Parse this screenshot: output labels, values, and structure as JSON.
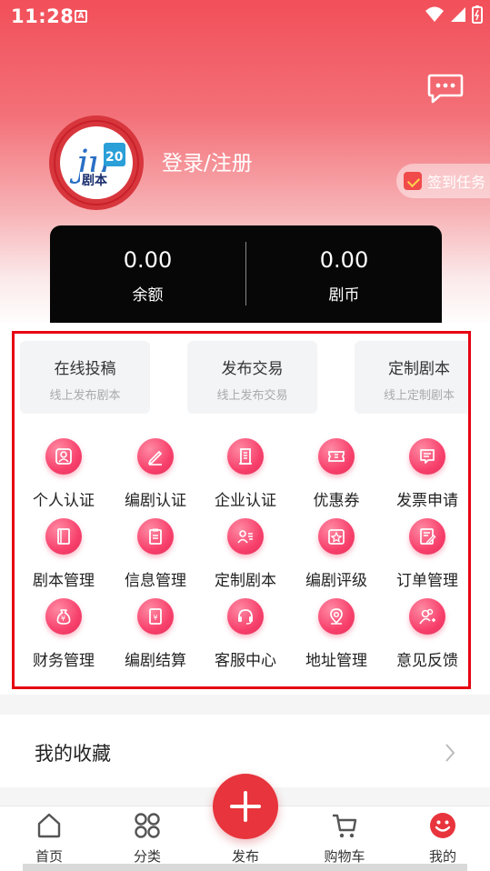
{
  "status": {
    "time": "11:28",
    "notif_icon": "A"
  },
  "header": {
    "login_label": "登录/注册",
    "checkin_label": "签到任务"
  },
  "balance": [
    {
      "value": "0.00",
      "label": "余额"
    },
    {
      "value": "0.00",
      "label": "剧币"
    }
  ],
  "quick": [
    {
      "title": "在线投稿",
      "sub": "线上发布剧本"
    },
    {
      "title": "发布交易",
      "sub": "线上发布交易"
    },
    {
      "title": "定制剧本",
      "sub": "线上定制剧本"
    }
  ],
  "grid": [
    {
      "label": "个人认证",
      "icon": "person-card-icon"
    },
    {
      "label": "编剧认证",
      "icon": "pencil-icon"
    },
    {
      "label": "企业认证",
      "icon": "building-icon"
    },
    {
      "label": "优惠券",
      "icon": "coupon-icon"
    },
    {
      "label": "发票申请",
      "icon": "invoice-icon"
    },
    {
      "label": "剧本管理",
      "icon": "book-icon"
    },
    {
      "label": "信息管理",
      "icon": "clipboard-icon"
    },
    {
      "label": "定制剧本",
      "icon": "user-list-icon"
    },
    {
      "label": "编剧评级",
      "icon": "star-box-icon"
    },
    {
      "label": "订单管理",
      "icon": "order-edit-icon"
    },
    {
      "label": "财务管理",
      "icon": "money-bag-icon"
    },
    {
      "label": "编剧结算",
      "icon": "ledger-icon"
    },
    {
      "label": "客服中心",
      "icon": "headset-icon"
    },
    {
      "label": "地址管理",
      "icon": "location-pin-icon"
    },
    {
      "label": "意见反馈",
      "icon": "feedback-users-icon"
    }
  ],
  "favorites": {
    "title": "我的收藏"
  },
  "tabs": [
    {
      "label": "首页",
      "icon": "home-icon"
    },
    {
      "label": "分类",
      "icon": "category-icon"
    },
    {
      "label": "发布",
      "icon": "plus-icon"
    },
    {
      "label": "购物车",
      "icon": "cart-icon"
    },
    {
      "label": "我的",
      "icon": "smile-icon"
    }
  ],
  "colors": {
    "accent": "#e8343c",
    "highlight_frame": "#e60012",
    "tab_active": "#e8343c",
    "icon_pink": "#f7416c"
  }
}
